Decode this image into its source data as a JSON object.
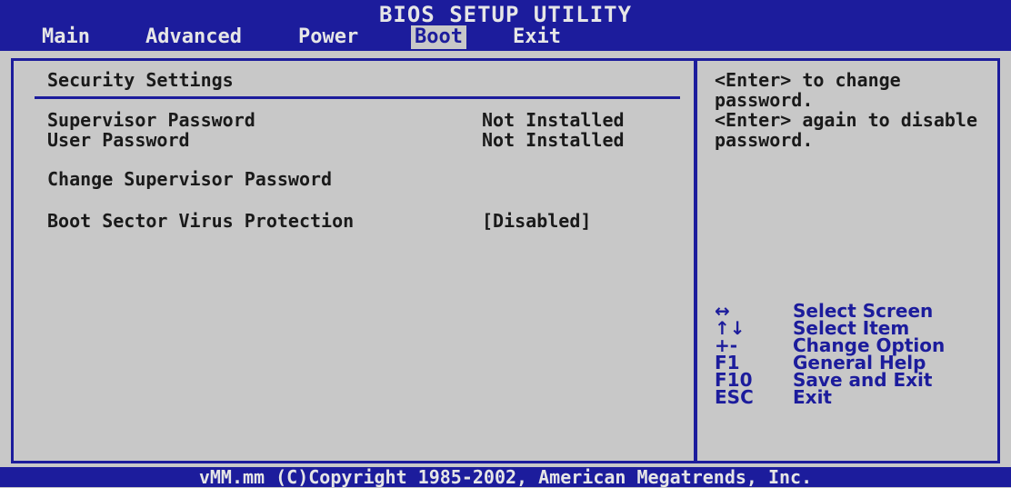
{
  "window": {
    "title": "BIOS SETUP UTILITY"
  },
  "tabs": [
    {
      "label": "Main"
    },
    {
      "label": "Advanced"
    },
    {
      "label": "Power"
    },
    {
      "label": "Boot",
      "active": true
    },
    {
      "label": "Exit"
    }
  ],
  "main": {
    "section_title": "Security Settings",
    "items": [
      {
        "label": "Supervisor Password",
        "value": "Not Installed"
      },
      {
        "label": "User Password",
        "value": "Not Installed"
      },
      {
        "label": "Change Supervisor Password",
        "value": ""
      },
      {
        "label": "Boot Sector Virus Protection",
        "value": "[Disabled]"
      }
    ]
  },
  "help": {
    "lines": [
      "<Enter> to change",
      "password.",
      "<Enter> again to disable",
      "password."
    ]
  },
  "keys": [
    {
      "key": "↔",
      "action": "Select Screen"
    },
    {
      "key": "↑↓",
      "action": "Select Item"
    },
    {
      "key": "+-",
      "action": "Change Option"
    },
    {
      "key": "F1",
      "action": "General Help"
    },
    {
      "key": "F10",
      "action": "Save and Exit"
    },
    {
      "key": "ESC",
      "action": "Exit"
    }
  ],
  "footer": {
    "text": "vMM.mm (C)Copyright 1985-2002, American Megatrends, Inc."
  },
  "colors": {
    "background": "#c8c8c8",
    "bar": "#1c1c9c",
    "bar_text": "#e6e6e6"
  }
}
